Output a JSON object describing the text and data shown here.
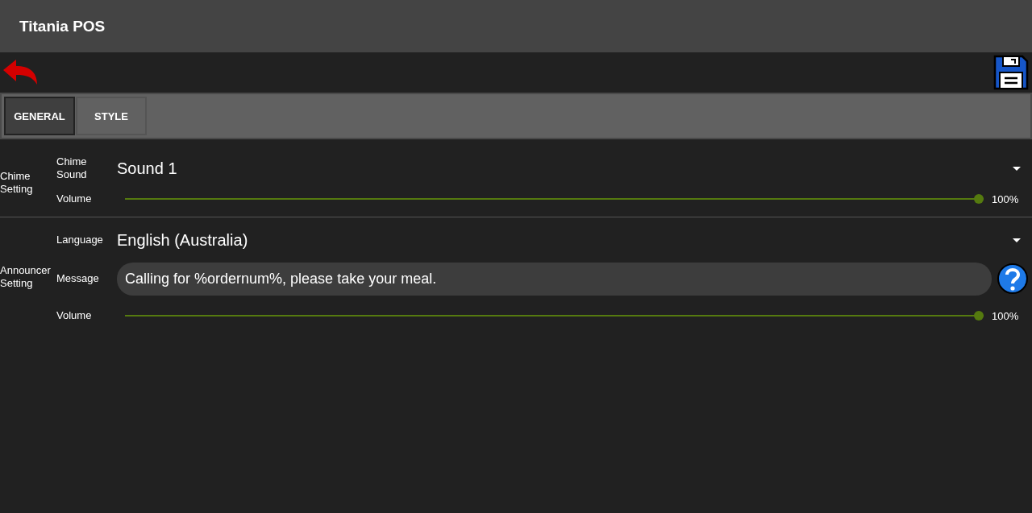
{
  "app_bar": {
    "title": "Titania POS"
  },
  "tabs": [
    {
      "label": "GENERAL",
      "selected": true
    },
    {
      "label": "STYLE",
      "selected": false
    }
  ],
  "sections": [
    {
      "title": "Chime\nSetting",
      "rows": [
        {
          "kind": "dropdown",
          "label": "Chime\nSound",
          "value": "Sound 1"
        },
        {
          "kind": "slider",
          "label": "Volume",
          "level": 1,
          "reading": "100%"
        }
      ]
    },
    {
      "title": "Announcer\nSetting",
      "rows": [
        {
          "kind": "dropdown",
          "label": "Language",
          "value": "English (Australia)"
        },
        {
          "kind": "text",
          "label": "Message",
          "value": "Calling for %ordernum%, please take your meal."
        },
        {
          "kind": "slider",
          "label": "Volume",
          "level": 1,
          "reading": "100%"
        }
      ]
    }
  ]
}
